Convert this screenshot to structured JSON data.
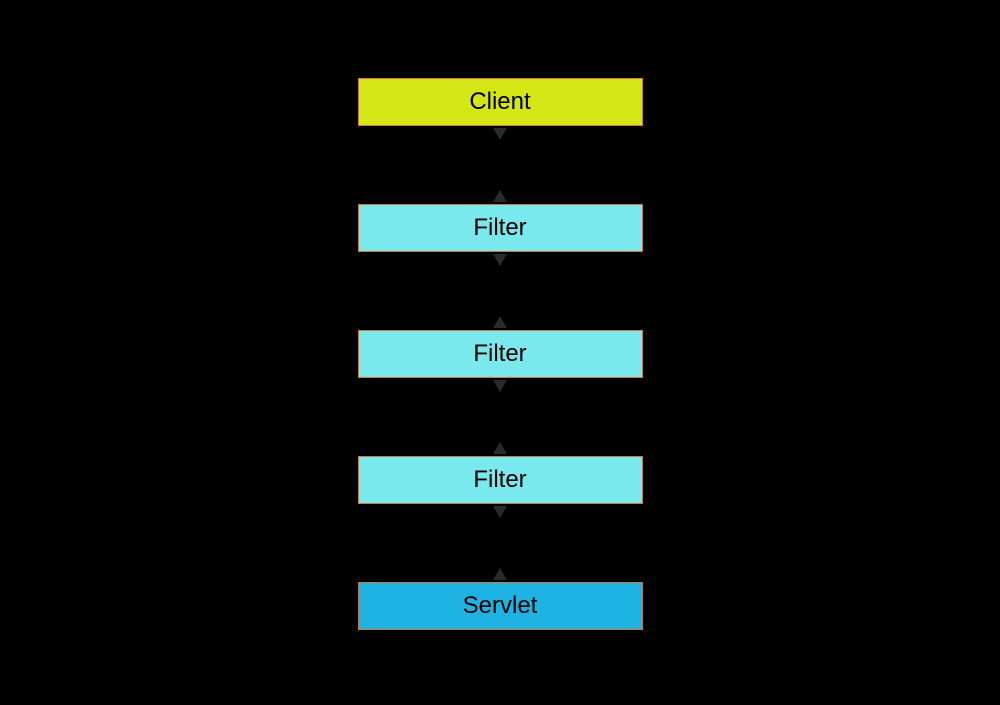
{
  "diagram": {
    "nodes": [
      {
        "label": "Client",
        "type": "client"
      },
      {
        "label": "Filter",
        "type": "filter"
      },
      {
        "label": "Filter",
        "type": "filter"
      },
      {
        "label": "Filter",
        "type": "filter"
      },
      {
        "label": "Servlet",
        "type": "servlet"
      }
    ],
    "colors": {
      "client": "#d4e615",
      "filter": "#7ae9ee",
      "servlet": "#1fb3e3",
      "background": "#000000",
      "border": "#c97840"
    }
  }
}
